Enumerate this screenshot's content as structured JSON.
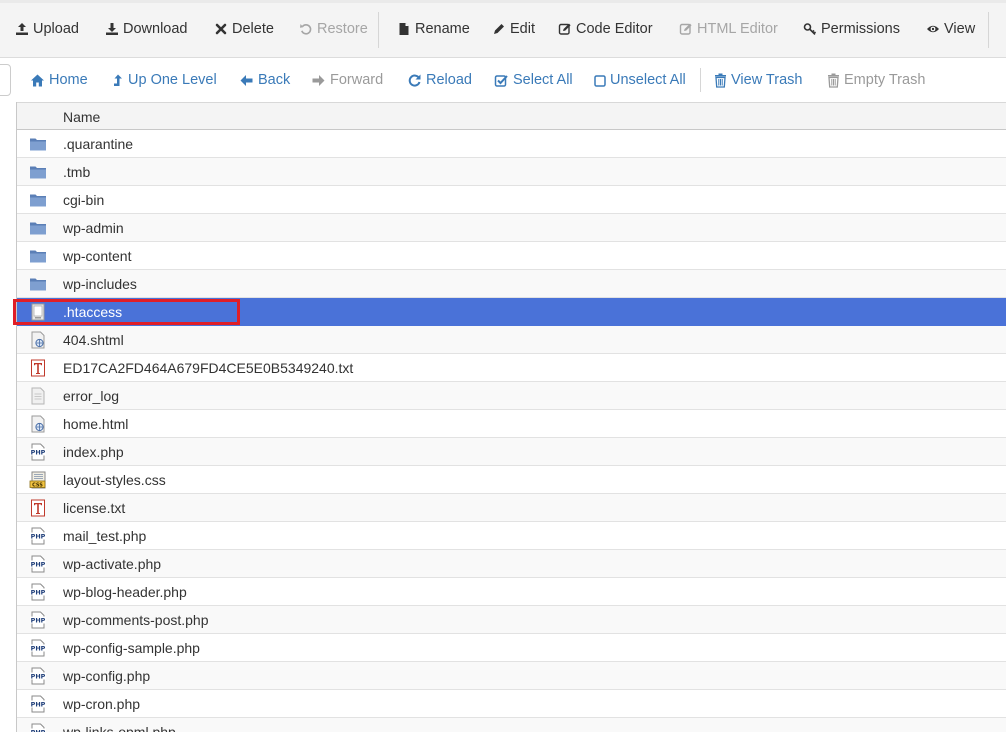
{
  "toolbar": {
    "items": [
      {
        "label": "Upload",
        "icon": "upload-icon",
        "disabled": false
      },
      {
        "label": "Download",
        "icon": "download-icon",
        "disabled": false
      },
      {
        "label": "Delete",
        "icon": "delete-icon",
        "disabled": false
      },
      {
        "label": "Restore",
        "icon": "restore-icon",
        "disabled": true
      },
      {
        "label": "Rename",
        "icon": "rename-icon",
        "disabled": false
      },
      {
        "label": "Edit",
        "icon": "pencil-icon",
        "disabled": false
      },
      {
        "label": "Code Editor",
        "icon": "code-editor-icon",
        "disabled": false
      },
      {
        "label": "HTML Editor",
        "icon": "html-editor-icon",
        "disabled": true
      },
      {
        "label": "Permissions",
        "icon": "key-icon",
        "disabled": false
      },
      {
        "label": "View",
        "icon": "eye-icon",
        "disabled": false
      }
    ]
  },
  "navbar": {
    "items": [
      {
        "label": "Home",
        "icon": "home-icon",
        "disabled": false
      },
      {
        "label": "Up One Level",
        "icon": "level-up-icon",
        "disabled": false
      },
      {
        "label": "Back",
        "icon": "arrow-left-icon",
        "disabled": false
      },
      {
        "label": "Forward",
        "icon": "arrow-right-icon",
        "disabled": true
      },
      {
        "label": "Reload",
        "icon": "reload-icon",
        "disabled": false
      },
      {
        "label": "Select All",
        "icon": "checkbox-checked-icon",
        "disabled": false
      },
      {
        "label": "Unselect All",
        "icon": "checkbox-empty-icon",
        "disabled": false
      },
      {
        "label": "View Trash",
        "icon": "trash-icon",
        "disabled": false
      },
      {
        "label": "Empty Trash",
        "icon": "trash-icon",
        "disabled": true
      }
    ]
  },
  "table": {
    "column_name": "Name",
    "rows": [
      {
        "name": ".quarantine",
        "type": "folder"
      },
      {
        "name": ".tmb",
        "type": "folder"
      },
      {
        "name": "cgi-bin",
        "type": "folder"
      },
      {
        "name": "wp-admin",
        "type": "folder"
      },
      {
        "name": "wp-content",
        "type": "folder"
      },
      {
        "name": "wp-includes",
        "type": "folder"
      },
      {
        "name": ".htaccess",
        "type": "htaccess",
        "selected": true
      },
      {
        "name": "404.shtml",
        "type": "html"
      },
      {
        "name": "ED17CA2FD464A679FD4CE5E0B5349240.txt",
        "type": "text"
      },
      {
        "name": "error_log",
        "type": "generic"
      },
      {
        "name": "home.html",
        "type": "html"
      },
      {
        "name": "index.php",
        "type": "php"
      },
      {
        "name": "layout-styles.css",
        "type": "css"
      },
      {
        "name": "license.txt",
        "type": "text"
      },
      {
        "name": "mail_test.php",
        "type": "php"
      },
      {
        "name": "wp-activate.php",
        "type": "php"
      },
      {
        "name": "wp-blog-header.php",
        "type": "php"
      },
      {
        "name": "wp-comments-post.php",
        "type": "php"
      },
      {
        "name": "wp-config-sample.php",
        "type": "php"
      },
      {
        "name": "wp-config.php",
        "type": "php"
      },
      {
        "name": "wp-cron.php",
        "type": "php"
      },
      {
        "name": "wp-links-opml.php",
        "type": "php"
      }
    ]
  },
  "colors": {
    "link": "#3a7ab8",
    "selected_row": "#4a72d8",
    "highlight_border": "#e01e27",
    "folder": "#6e8fc0"
  }
}
